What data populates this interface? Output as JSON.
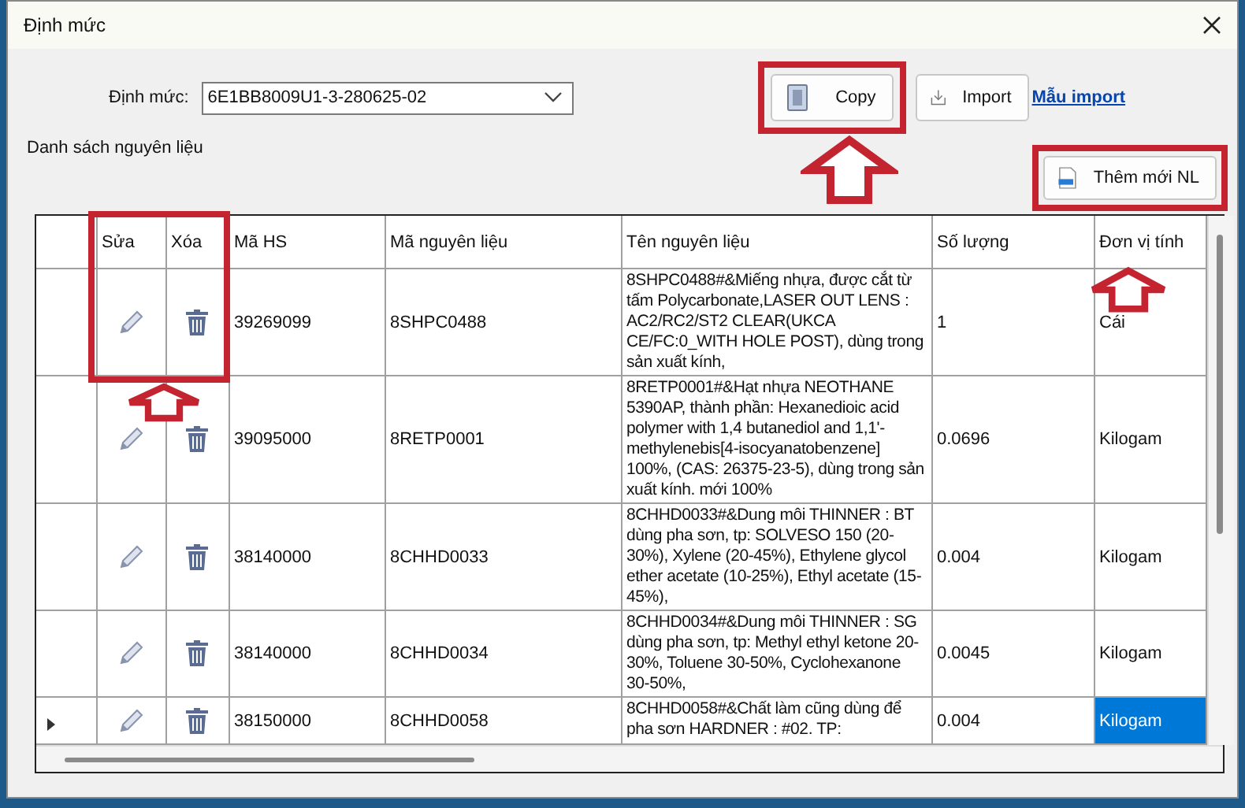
{
  "window": {
    "title": "Định mức"
  },
  "norm_field": {
    "label": "Định mức:",
    "value": "6E1BB8009U1-3-280625-02"
  },
  "buttons": [
    {
      "label": "Copy",
      "kind": "copy",
      "highlighted": true
    },
    {
      "label": "Import",
      "kind": "import",
      "highlighted": false
    }
  ],
  "link": "Mẫu import",
  "group_title": "Danh sách nguyên liệu",
  "add_button": {
    "label": "Thêm mới NL",
    "highlighted": true
  },
  "table": {
    "columns_highlighted": true,
    "columns": [
      "Sửa",
      "Xóa",
      "Mã HS",
      "Mã nguyên liệu",
      "Tên nguyên liệu",
      "Số lượng",
      "Đơn vị tính"
    ],
    "rows": [
      {
        "current": false,
        "hs": "39269099",
        "code": "8SHPC0488",
        "name": "8SHPC0488#&Miếng nhựa, được cắt từ tấm Polycarbonate,LASER OUT LENS : AC2/RC2/ST2 CLEAR(UKCA CE/FC:0_WITH HOLE POST), dùng trong sản xuất kính,",
        "qty": "1",
        "unit": "Cái",
        "unit_selected": false
      },
      {
        "current": false,
        "hs": "39095000",
        "code": "8RETP0001",
        "name": "8RETP0001#&Hạt nhựa NEOTHANE 5390AP, thành phần: Hexanedioic acid polymer with 1,4 butanediol and 1,1'-methylenebis[4-isocyanatobenzene] 100%, (CAS: 26375-23-5), dùng trong sản xuất kính. mới 100%",
        "qty": "0.0696",
        "unit": "Kilogam",
        "unit_selected": false
      },
      {
        "current": false,
        "hs": "38140000",
        "code": "8CHHD0033",
        "name": "8CHHD0033#&Dung môi THINNER : BT dùng pha sơn, tp: SOLVESO 150 (20-30%), Xylene (20-45%), Ethylene glycol ether acetate (10-25%), Ethyl acetate (15-45%),",
        "qty": "0.004",
        "unit": "Kilogam",
        "unit_selected": false
      },
      {
        "current": false,
        "hs": "38140000",
        "code": "8CHHD0034",
        "name": "8CHHD0034#&Dung môi THINNER : SG dùng pha sơn, tp: Methyl ethyl ketone 20-30%, Toluene 30-50%, Cyclohexanone 30-50%,",
        "qty": "0.0045",
        "unit": "Kilogam",
        "unit_selected": false
      },
      {
        "current": true,
        "hs": "38150000",
        "code": "8CHHD0058",
        "name": "8CHHD0058#&Chất làm cũng dùng để pha sơn HARDNER : #02. TP:",
        "qty": "0.004",
        "unit": "Kilogam",
        "unit_selected": true
      }
    ]
  }
}
